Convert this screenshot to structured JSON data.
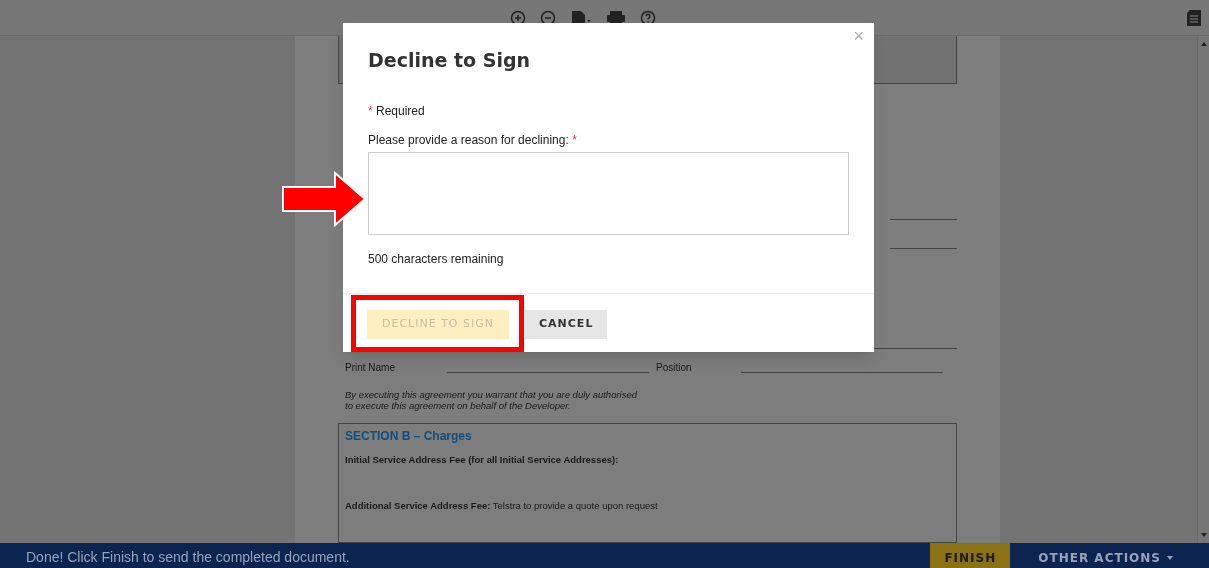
{
  "document": {
    "print_name_label": "Print Name",
    "position_label": "Position",
    "authorisation_note": "By executing this agreement you warrant that you are duly authorised to execute this agreement on behalf of the Developer.",
    "section_b": {
      "title": "SECTION B – Charges",
      "rows": [
        {
          "label": "Initial Service Address Fee (for all Initial Service Addresses):"
        },
        {
          "label": "Additional Service Address Fee:",
          "value": "Telstra to provide a quote upon request"
        }
      ]
    }
  },
  "modal": {
    "title": "Decline to Sign",
    "close": "×",
    "required_mark": "*",
    "required_note": "Required",
    "field_label": "Please provide a reason for declining:",
    "field_required_mark": "*",
    "counter": "500 characters remaining",
    "buttons": [
      {
        "label": "DECLINE TO SIGN",
        "kind": "primary",
        "disabled": true
      },
      {
        "label": "CANCEL",
        "kind": "secondary",
        "disabled": false
      }
    ]
  },
  "bottom_bar": {
    "message": "Done! Click Finish to send the completed document.",
    "finish": "FINISH",
    "other_actions": "OTHER ACTIONS"
  }
}
